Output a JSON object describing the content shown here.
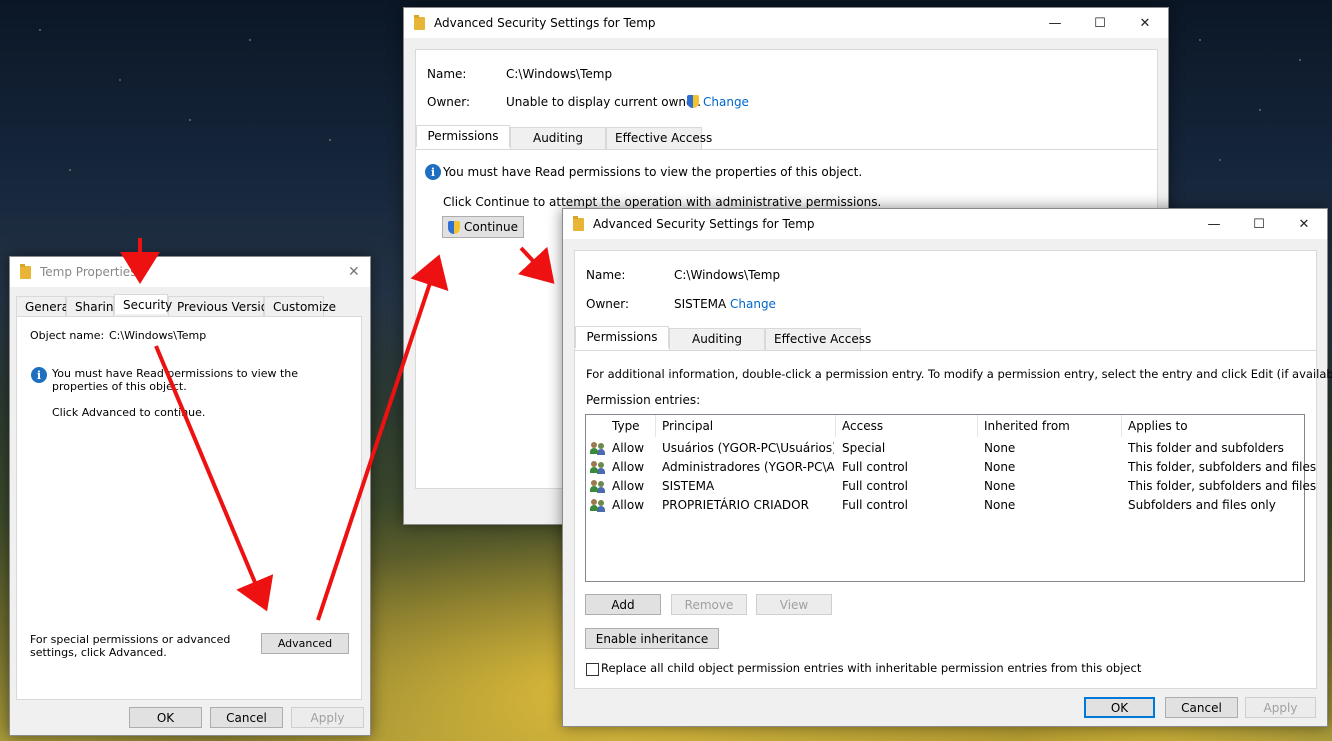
{
  "win1": {
    "title": "Temp Properties",
    "tabs": [
      "General",
      "Sharing",
      "Security",
      "Previous Versions",
      "Customize"
    ],
    "object_name_label": "Object name:",
    "object_name_value": "C:\\Windows\\Temp",
    "info_message": "You must have Read permissions to view the properties of this object.",
    "advanced_hint": "Click Advanced to continue.",
    "special_label": "For special permissions or advanced settings, click Advanced.",
    "advanced_button": "Advanced",
    "ok_button": "OK",
    "cancel_button": "Cancel",
    "apply_button": "Apply"
  },
  "win2": {
    "title": "Advanced Security Settings for Temp",
    "name_label": "Name:",
    "name_value": "C:\\Windows\\Temp",
    "owner_label": "Owner:",
    "owner_value": "Unable to display current owner.",
    "change_link": "Change",
    "tabs": [
      "Permissions",
      "Auditing",
      "Effective Access"
    ],
    "info_message": "You must have Read permissions to view the properties of this object.",
    "continue_hint": "Click Continue to attempt the operation with administrative permissions.",
    "continue_button": "Continue"
  },
  "win3": {
    "title": "Advanced Security Settings for Temp",
    "name_label": "Name:",
    "name_value": "C:\\Windows\\Temp",
    "owner_label": "Owner:",
    "owner_value": "SISTEMA",
    "change_link": "Change",
    "tabs": [
      "Permissions",
      "Auditing",
      "Effective Access"
    ],
    "info_text": "For additional information, double-click a permission entry. To modify a permission entry, select the entry and click Edit (if available).",
    "entries_label": "Permission entries:",
    "columns": [
      "Type",
      "Principal",
      "Access",
      "Inherited from",
      "Applies to"
    ],
    "rows": [
      {
        "type": "Allow",
        "principal": "Usuários (YGOR-PC\\Usuários)",
        "access": "Special",
        "inherited": "None",
        "applies": "This folder and subfolders"
      },
      {
        "type": "Allow",
        "principal": "Administradores (YGOR-PC\\A...",
        "access": "Full control",
        "inherited": "None",
        "applies": "This folder, subfolders and files"
      },
      {
        "type": "Allow",
        "principal": "SISTEMA",
        "access": "Full control",
        "inherited": "None",
        "applies": "This folder, subfolders and files"
      },
      {
        "type": "Allow",
        "principal": "PROPRIETÁRIO CRIADOR",
        "access": "Full control",
        "inherited": "None",
        "applies": "Subfolders and files only"
      }
    ],
    "add_button": "Add",
    "remove_button": "Remove",
    "view_button": "View",
    "enable_inheritance_button": "Enable inheritance",
    "replace_checkbox_label": "Replace all child object permission entries with inheritable permission entries from this object",
    "ok_button": "OK",
    "cancel_button": "Cancel",
    "apply_button": "Apply"
  },
  "colors": {
    "accent": "#0078d7",
    "link": "#0066cc",
    "arrow": "#ee1111"
  }
}
